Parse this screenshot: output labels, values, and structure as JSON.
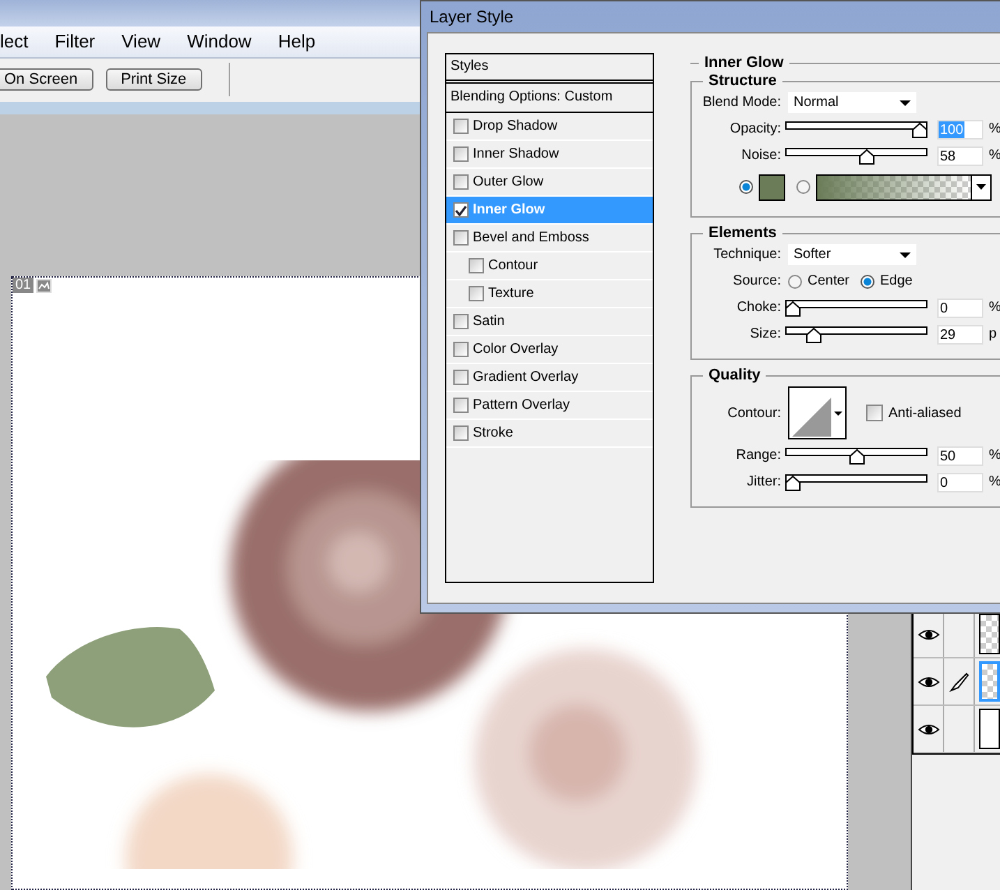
{
  "menu_bar": {
    "items": [
      "lect",
      "Filter",
      "View",
      "Window",
      "Help"
    ]
  },
  "toolbar": {
    "buttons": [
      "On Screen",
      "Print Size"
    ]
  },
  "document": {
    "tab_label": "01"
  },
  "dialog": {
    "title": "Layer Style",
    "styles_list": {
      "header": "Styles",
      "blending_options": "Blending Options: Custom",
      "items": [
        {
          "label": "Drop Shadow",
          "checked": false,
          "selected": false
        },
        {
          "label": "Inner Shadow",
          "checked": false,
          "selected": false
        },
        {
          "label": "Outer Glow",
          "checked": false,
          "selected": false
        },
        {
          "label": "Inner Glow",
          "checked": true,
          "selected": true
        },
        {
          "label": "Bevel and Emboss",
          "checked": false,
          "selected": false,
          "children": [
            {
              "label": "Contour",
              "checked": false,
              "selected": false
            },
            {
              "label": "Texture",
              "checked": false,
              "selected": false
            }
          ]
        },
        {
          "label": "Satin",
          "checked": false,
          "selected": false
        },
        {
          "label": "Color Overlay",
          "checked": false,
          "selected": false
        },
        {
          "label": "Gradient Overlay",
          "checked": false,
          "selected": false
        },
        {
          "label": "Pattern Overlay",
          "checked": false,
          "selected": false
        },
        {
          "label": "Stroke",
          "checked": false,
          "selected": false
        }
      ]
    },
    "panel_title": "Inner Glow",
    "groups": [
      {
        "title": "Structure",
        "rows": [
          {
            "kind": "dropdown",
            "label": "Blend Mode:",
            "value": "Normal"
          },
          {
            "kind": "slider",
            "label": "Opacity:",
            "level": 1.0,
            "value": "100",
            "unit": "%",
            "highlighted": true
          },
          {
            "kind": "slider",
            "label": "Noise:",
            "level": 0.58,
            "value": "58",
            "unit": "%",
            "highlighted": false
          },
          {
            "kind": "fill",
            "options": [
              {
                "kind": "solid",
                "selected": true
              },
              {
                "kind": "gradient",
                "selected": false
              }
            ]
          }
        ]
      },
      {
        "title": "Elements",
        "rows": [
          {
            "kind": "dropdown",
            "label": "Technique:",
            "value": "Softer"
          },
          {
            "kind": "radio",
            "label": "Source:",
            "options": [
              {
                "label": "Center",
                "selected": false
              },
              {
                "label": "Edge",
                "selected": true
              }
            ]
          },
          {
            "kind": "slider",
            "label": "Choke:",
            "level": 0,
            "value": "0",
            "unit": "%",
            "highlighted": false
          },
          {
            "kind": "slider",
            "label": "Size:",
            "level": 0.17,
            "value": "29",
            "unit": "p",
            "highlighted": false
          }
        ]
      },
      {
        "title": "Quality",
        "rows": [
          {
            "kind": "contour",
            "label": "Contour:",
            "checkbox_label": "Anti-aliased",
            "checked": false
          },
          {
            "kind": "slider",
            "label": "Range:",
            "level": 0.5,
            "value": "50",
            "unit": "%",
            "highlighted": false
          },
          {
            "kind": "slider",
            "label": "Jitter:",
            "level": 0,
            "value": "0",
            "unit": "%",
            "highlighted": false
          }
        ]
      }
    ]
  },
  "layers": [
    {
      "visible": true,
      "brush": false,
      "selected": false,
      "kind": "transparent"
    },
    {
      "visible": true,
      "brush": true,
      "selected": true,
      "kind": "transparent"
    },
    {
      "visible": true,
      "brush": false,
      "selected": false,
      "kind": "white"
    }
  ]
}
